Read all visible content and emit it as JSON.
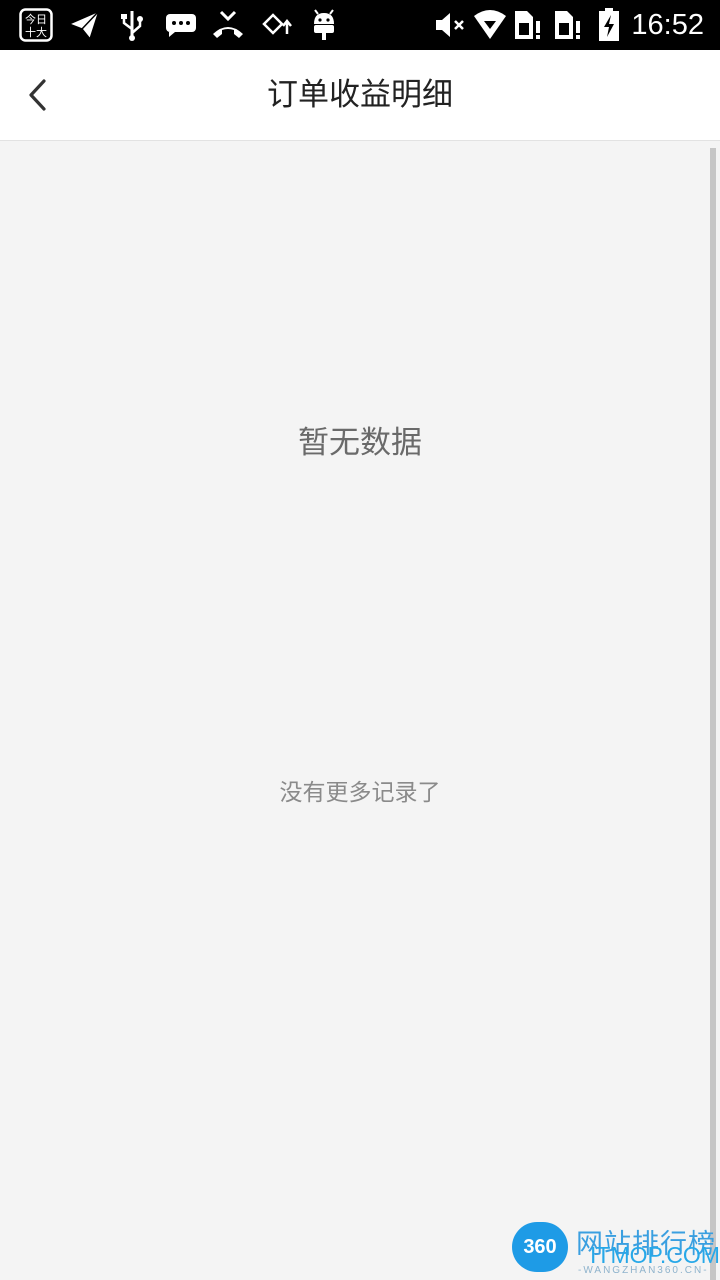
{
  "status_bar": {
    "time": "16:52",
    "app_badge": "今日\n十大",
    "left_icons": [
      "news-app-icon",
      "send-icon",
      "usb-icon",
      "message-icon",
      "missed-call-icon",
      "rotation-icon",
      "android-icon"
    ],
    "right_icons": [
      "mute-icon",
      "wifi-icon",
      "sim1-icon",
      "sim2-icon",
      "battery-icon"
    ]
  },
  "header": {
    "title": "订单收益明细",
    "back_icon": "chevron-left-icon"
  },
  "content": {
    "empty_message": "暂无数据",
    "no_more_message": "没有更多记录了"
  },
  "watermark": {
    "badge": "360",
    "site_cn": "网站排行榜",
    "brand": "ITMOP.COM",
    "url": "-WANGZHAN360.CN-"
  }
}
